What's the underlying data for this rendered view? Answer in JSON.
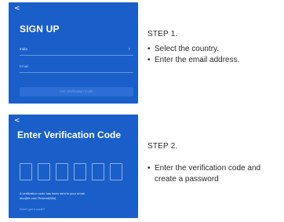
{
  "step1": {
    "screen": {
      "back_glyph": "<",
      "title": "SIGN UP",
      "country_value": "India",
      "email_placeholder": "Email",
      "get_code_button": "Get Verification Code"
    },
    "label": "STEP 1.",
    "bullets": [
      "Select the country.",
      "Enter the email address."
    ]
  },
  "step2": {
    "screen": {
      "back_glyph": "<",
      "title": "Enter Verification Code",
      "code_box_count": 6,
      "message_line1": "A verification code has been sent to your email",
      "message_line2": "abc@fx.com Resend(60s)",
      "resend_link": "Didn't get a code?"
    },
    "label": "STEP 2.",
    "bullets": [
      "Enter the verification code and create a password"
    ]
  },
  "colors": {
    "screen_bg": "#1a5fc9",
    "text_dark": "#2a2a2a",
    "white": "#ffffff"
  },
  "icons": {
    "back": "chevron-left-icon",
    "country_select": "chevron-right-icon"
  }
}
